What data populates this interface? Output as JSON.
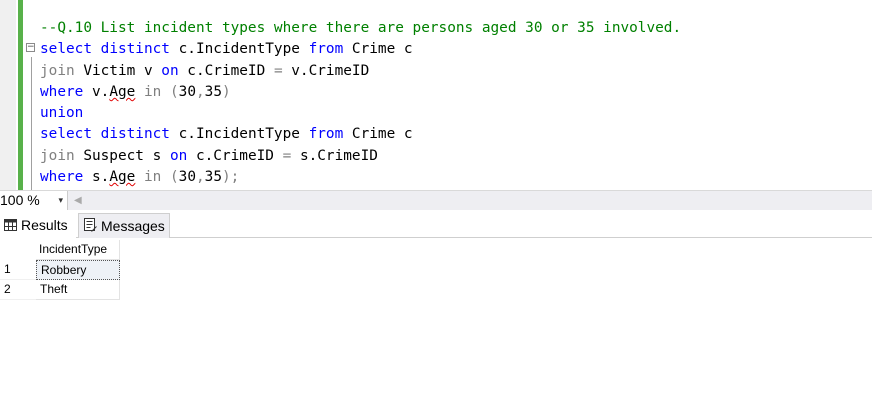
{
  "editor": {
    "fold_symbol": "−",
    "lines": [
      [
        {
          "t": "--Q.10 List incident types where there are persons aged 30 or 35 involved.",
          "c": "cm"
        }
      ],
      [
        {
          "t": "select",
          "c": "kw"
        },
        {
          "t": " "
        },
        {
          "t": "distinct",
          "c": "kw"
        },
        {
          "t": " c.IncidentType "
        },
        {
          "t": "from",
          "c": "kw"
        },
        {
          "t": " Crime c"
        }
      ],
      [
        {
          "t": "join",
          "c": "op"
        },
        {
          "t": " Victim v "
        },
        {
          "t": "on",
          "c": "kw"
        },
        {
          "t": " c.CrimeID "
        },
        {
          "t": "=",
          "c": "op"
        },
        {
          "t": " v.CrimeID"
        }
      ],
      [
        {
          "t": "where",
          "c": "kw"
        },
        {
          "t": " v."
        },
        {
          "t": "Age",
          "c": "squig"
        },
        {
          "t": " "
        },
        {
          "t": "in",
          "c": "op"
        },
        {
          "t": " "
        },
        {
          "t": "(",
          "c": "op"
        },
        {
          "t": "30"
        },
        {
          "t": ",",
          "c": "op"
        },
        {
          "t": "35"
        },
        {
          "t": ")",
          "c": "op"
        }
      ],
      [
        {
          "t": "union",
          "c": "kw"
        }
      ],
      [
        {
          "t": "select",
          "c": "kw"
        },
        {
          "t": " "
        },
        {
          "t": "distinct",
          "c": "kw"
        },
        {
          "t": " c.IncidentType "
        },
        {
          "t": "from",
          "c": "kw"
        },
        {
          "t": " Crime c"
        }
      ],
      [
        {
          "t": "join",
          "c": "op"
        },
        {
          "t": " Suspect s "
        },
        {
          "t": "on",
          "c": "kw"
        },
        {
          "t": " c.CrimeID "
        },
        {
          "t": "=",
          "c": "op"
        },
        {
          "t": " s.CrimeID"
        }
      ],
      [
        {
          "t": "where",
          "c": "kw"
        },
        {
          "t": " s."
        },
        {
          "t": "Age",
          "c": "squig"
        },
        {
          "t": " "
        },
        {
          "t": "in",
          "c": "op"
        },
        {
          "t": " "
        },
        {
          "t": "(",
          "c": "op"
        },
        {
          "t": "30"
        },
        {
          "t": ",",
          "c": "op"
        },
        {
          "t": "35"
        },
        {
          "t": ")",
          "c": "op"
        },
        {
          "t": ";",
          "c": "op"
        }
      ]
    ]
  },
  "zoom": {
    "value": "100 %",
    "arrow": "▾",
    "scroll_left": "◀"
  },
  "tabs": {
    "results": "Results",
    "messages": "Messages"
  },
  "grid": {
    "columns": [
      "IncidentType"
    ],
    "rows": [
      {
        "num": "1",
        "cells": [
          "Robbery"
        ]
      },
      {
        "num": "2",
        "cells": [
          "Theft"
        ]
      }
    ]
  },
  "colors": {
    "keyword": "#0000ff",
    "comment": "#008000",
    "operator": "#808080",
    "change_bar": "#58b14a",
    "squiggle": "#e00000"
  }
}
